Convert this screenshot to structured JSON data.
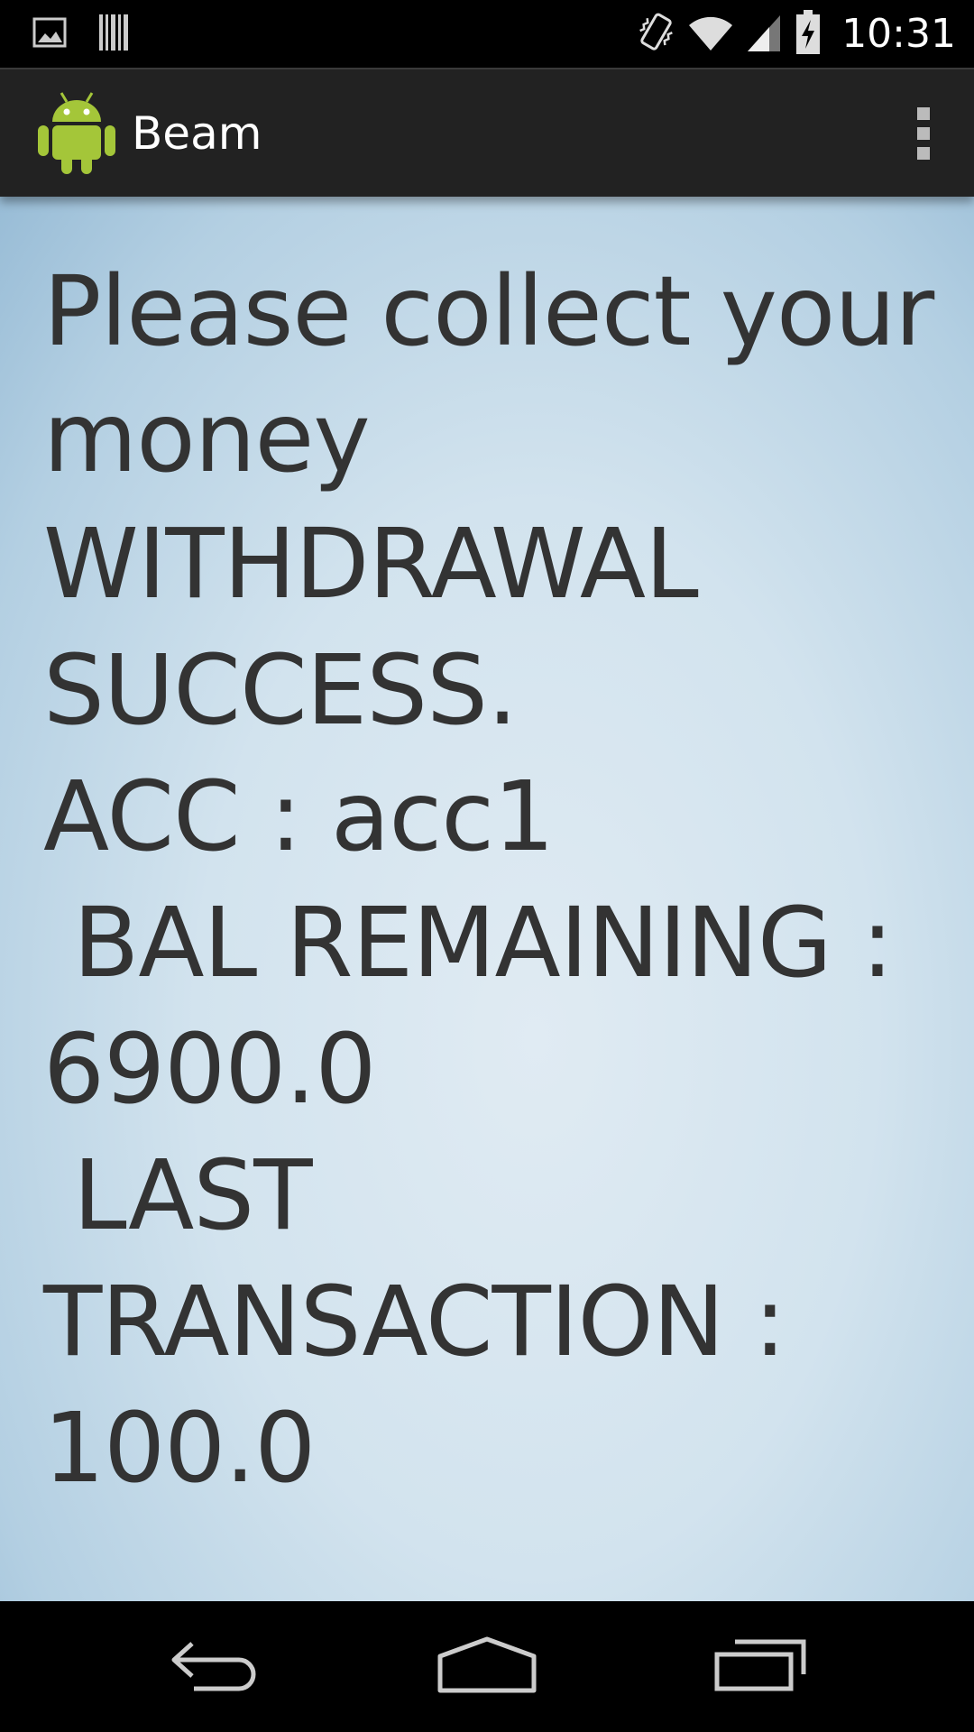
{
  "status_bar": {
    "time": "10:31",
    "left_icons": [
      "gallery-icon",
      "barcode-icon"
    ],
    "right_icons": [
      "vibrate-icon",
      "wifi-icon",
      "signal-icon",
      "battery-charging-icon"
    ]
  },
  "action_bar": {
    "title": "Beam",
    "app_icon": "android-icon",
    "overflow_icon": "overflow-menu-icon"
  },
  "main": {
    "message": "Please collect your money WITHDRAWAL SUCCESS.\nACC : acc1\n BAL REMAINING : 6900.0\n LAST TRANSACTION : 100.0"
  },
  "nav_bar": {
    "buttons": [
      "back-icon",
      "home-icon",
      "recents-icon"
    ]
  },
  "colors": {
    "status_bar_bg": "#000000",
    "action_bar_bg": "#222222",
    "content_bg": "#d2e3ee",
    "text": "#333333",
    "android_green": "#a4c639"
  }
}
